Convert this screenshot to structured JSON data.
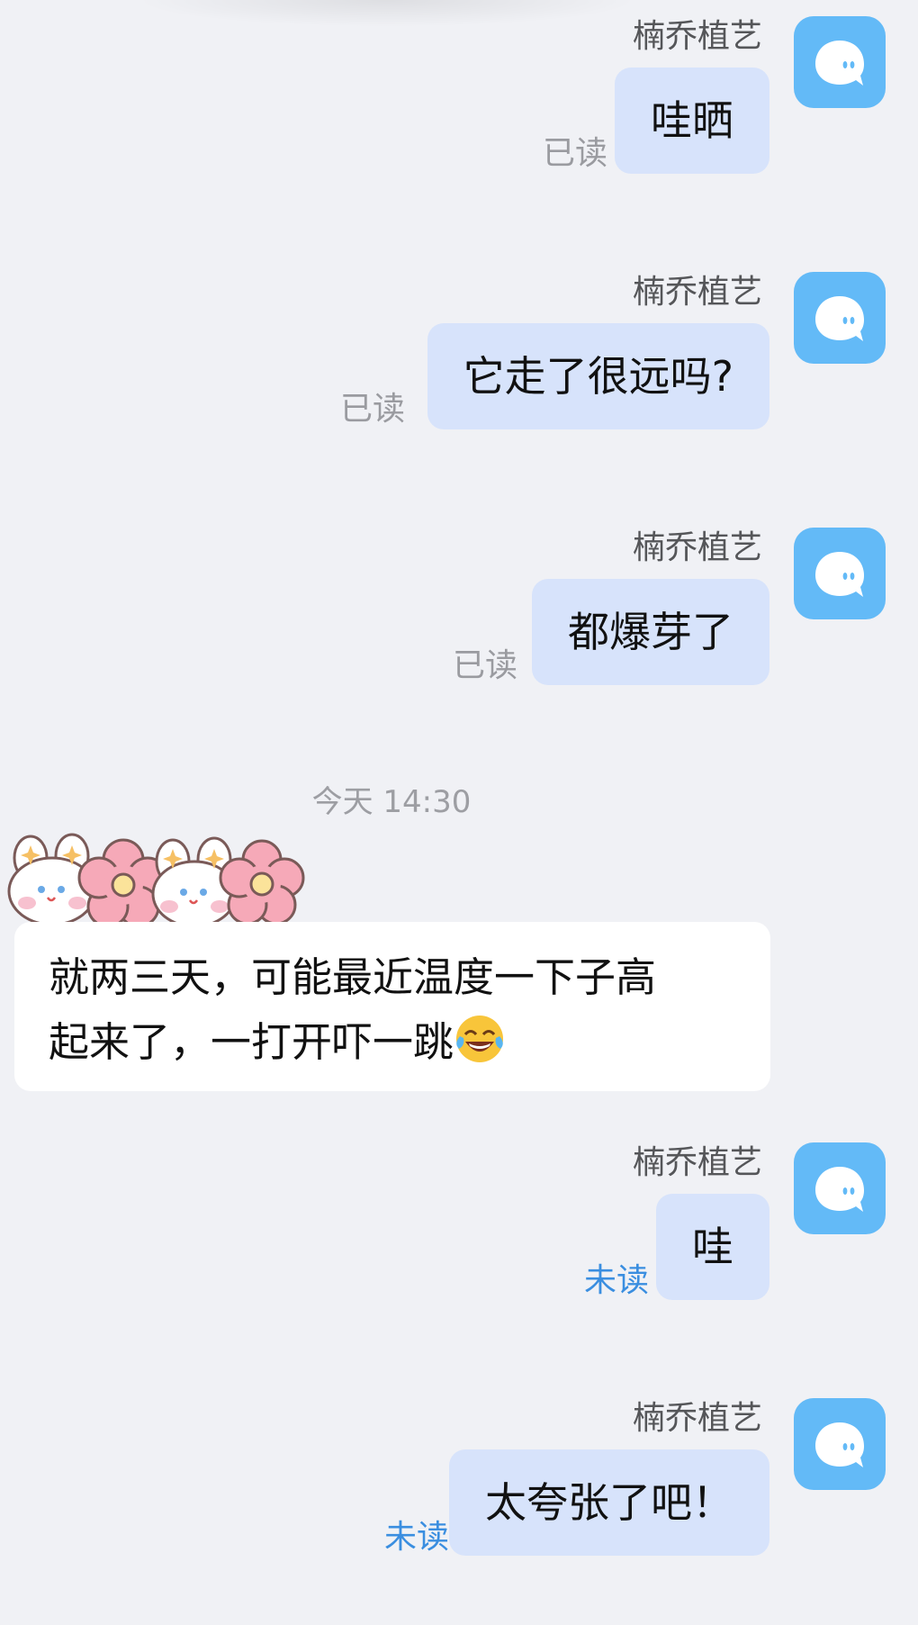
{
  "contact": {
    "name": "楠乔植艺",
    "avatar_icon": "chat-bubble-avatar-icon",
    "avatar_color": "#63baf7"
  },
  "messages_before": [
    {
      "text": "哇晒",
      "status": "已读"
    },
    {
      "text": "它走了很远吗?",
      "status": "已读"
    },
    {
      "text": "都爆芽了",
      "status": "已读"
    }
  ],
  "timestamp": "今天 14:30",
  "incoming": {
    "sticker_icon": "bunny-flower-sticker",
    "line1": "就两三天，可能最近温度一下子高",
    "line2": "起来了，一打开吓一跳",
    "emoji": "tears-of-joy-emoji"
  },
  "messages_after": [
    {
      "text": "哇",
      "status": "未读"
    },
    {
      "text": "太夸张了吧！",
      "status": "未读"
    }
  ],
  "colors": {
    "background": "#f0f1f5",
    "outgoing_bubble": "#d7e3fb",
    "incoming_bubble": "#ffffff",
    "read_status": "#9a9ba0",
    "unread_status": "#3a8ee0"
  }
}
